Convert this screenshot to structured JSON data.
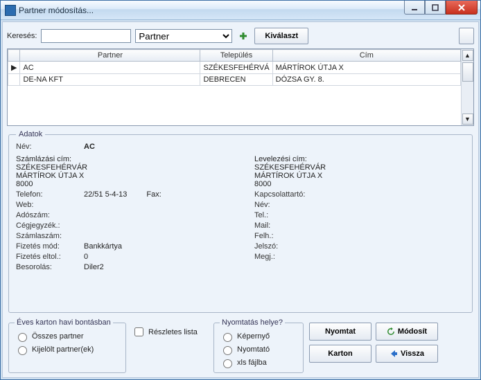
{
  "window": {
    "title": "Partner módosítás..."
  },
  "search": {
    "label": "Keresés:",
    "input_value": "",
    "dropdown_selected": "Partner",
    "kivalaszt_label": "Kiválaszt"
  },
  "grid": {
    "columns": [
      "Partner",
      "Település",
      "Cím"
    ],
    "rows": [
      {
        "partner": "AC",
        "telepules": "SZÉKESFEHÉRVÁ",
        "cim": "MÁRTÍROK ÚTJA X",
        "current": true
      },
      {
        "partner": "DE-NA KFT",
        "telepules": "DEBRECEN",
        "cim": "DÓZSA GY. 8.",
        "current": false
      }
    ]
  },
  "adatok": {
    "legend": "Adatok",
    "nev_label": "Név:",
    "nev_value": "AC",
    "szamlazasi_label": "Számlázási cím:",
    "szamlazasi_city": "SZÉKESFEHÉRVÁR",
    "szamlazasi_street": "MÁRTÍROK ÚTJA X",
    "szamlazasi_zip": "8000",
    "levelezesi_label": "Levelezési cím:",
    "levelezesi_city": "SZÉKESFEHÉRVÁR",
    "levelezesi_street": "MÁRTÍROK ÚTJA X",
    "levelezesi_zip": "8000",
    "telefon_label": "Telefon:",
    "telefon_value": "22/51 5-4-13",
    "fax_label": "Fax:",
    "fax_value": "",
    "kapcsolattarto_label": "Kapcsolattartó:",
    "kapcsolattarto_value": "",
    "web_label": "Web:",
    "web_value": "",
    "nev2_label": "Név:",
    "nev2_value": "",
    "adoszam_label": "Adószám:",
    "adoszam_value": "",
    "tel_label": "Tel.:",
    "tel_value": "",
    "cegjegyzek_label": "Cégjegyzék.:",
    "cegjegyzek_value": "",
    "mail_label": "Mail:",
    "mail_value": "",
    "szamlaszam_label": "Számlaszám:",
    "szamlaszam_value": "",
    "felh_label": "Felh.:",
    "felh_value": "",
    "fizmod_label": "Fizetés mód:",
    "fizmod_value": "Bankkártya",
    "jelszo_label": "Jelszó:",
    "jelszo_value": "",
    "fizeltol_label": "Fizetés eltol.:",
    "fizeltol_value": "0",
    "megj_label": "Megj.:",
    "megj_value": "",
    "besorolas_label": "Besorolás:",
    "besorolas_value": "Diler2"
  },
  "bottom": {
    "karton_legend": "Éves karton havi bontásban",
    "osszes_label": "Összes partner",
    "kijelolt_label": "Kijelölt partner(ek)",
    "reszletes_label": "Részletes lista",
    "nyomtatas_legend": "Nyomtatás helye?",
    "kepernyo_label": "Képernyő",
    "nyomtato_label": "Nyomtató",
    "xls_label": "xls fájlba",
    "nyomtat_btn": "Nyomtat",
    "modosit_btn": "Módosít",
    "karton_btn": "Karton",
    "vissza_btn": "Vissza"
  }
}
